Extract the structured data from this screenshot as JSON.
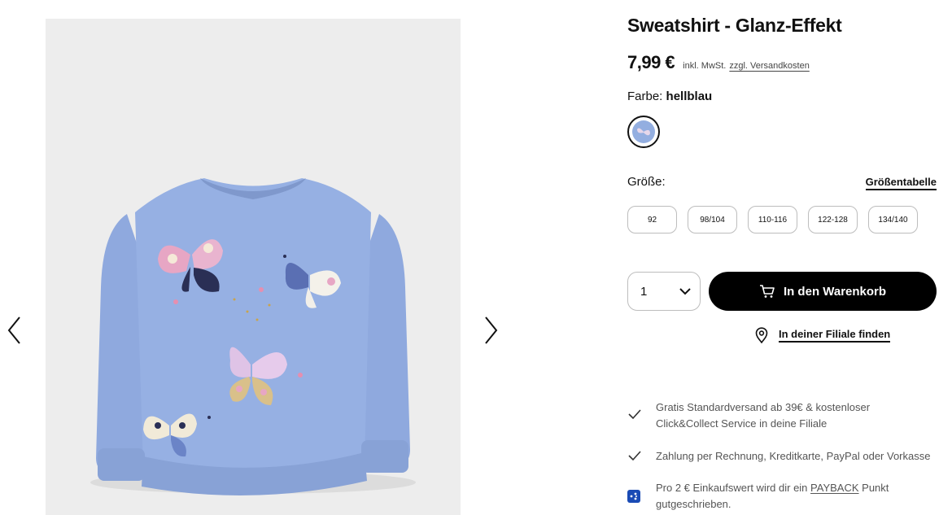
{
  "product": {
    "title": "Sweatshirt - Glanz-Effekt",
    "price": "7,99 €",
    "tax_note": "inkl. MwSt.",
    "shipping_link": "zzgl. Versandkosten",
    "color_label": "Farbe:",
    "color_value": "hellblau",
    "color_swatch": "#93aee0"
  },
  "gallery": {
    "wishlist_icon": "heart-outline-icon",
    "prev_icon": "chevron-left-icon",
    "next_icon": "chevron-right-icon",
    "background": "#ededed",
    "garment_color": "#93aee0"
  },
  "size": {
    "label": "Größe:",
    "table_link": "Größentabelle",
    "options": [
      "92",
      "98/104",
      "110-116",
      "122-128",
      "134/140"
    ]
  },
  "purchase": {
    "quantity": "1",
    "cart_button": "In den Warenkorb",
    "store_link": "In deiner Filiale finden"
  },
  "benefits": {
    "shipping_line1": "Gratis Standardversand ab 39€ & kostenloser",
    "shipping_line2": "Click&Collect Service in deine Filiale",
    "payment": "Zahlung per Rechnung, Kreditkarte, PayPal oder Vorkasse",
    "payback_before": "Pro 2 € Einkaufswert wird dir ein",
    "payback_link": "PAYBACK",
    "payback_after": "Punkt",
    "payback_line2": "gutgeschrieben."
  }
}
